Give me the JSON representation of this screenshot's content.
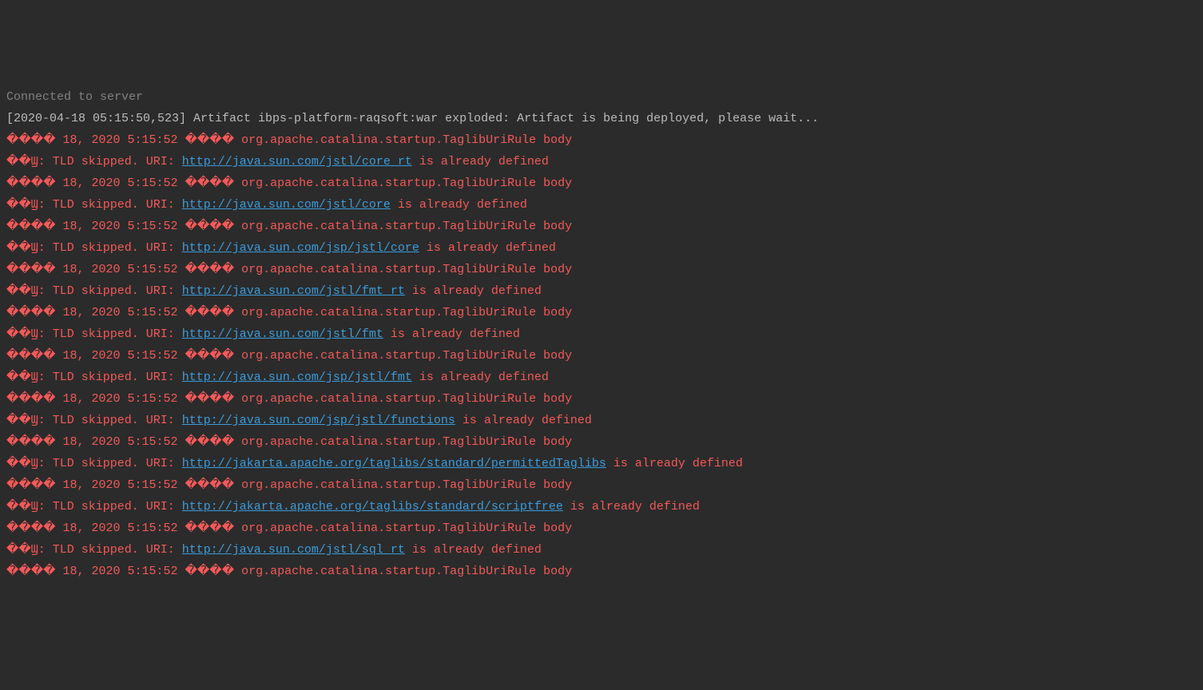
{
  "top_line": "Connected to server",
  "deploy_line": "[2020-04-18 05:15:50,523] Artifact ibps-platform-raqsoft:war exploded: Artifact is being deployed, please wait...",
  "garbled_header": "���� 18, 2020 5:15:52 ���� org.apache.catalina.startup.TaglibUriRule body",
  "tld_prefix": "��Ϣ: TLD skipped. URI: ",
  "tld_suffix": " is already defined",
  "uris": [
    "http://java.sun.com/jstl/core_rt",
    "http://java.sun.com/jstl/core",
    "http://java.sun.com/jsp/jstl/core",
    "http://java.sun.com/jstl/fmt_rt",
    "http://java.sun.com/jstl/fmt",
    "http://java.sun.com/jsp/jstl/fmt",
    "http://java.sun.com/jsp/jstl/functions",
    "http://jakarta.apache.org/taglibs/standard/permittedTaglibs",
    "http://jakarta.apache.org/taglibs/standard/scriptfree",
    "http://java.sun.com/jstl/sql_rt"
  ]
}
